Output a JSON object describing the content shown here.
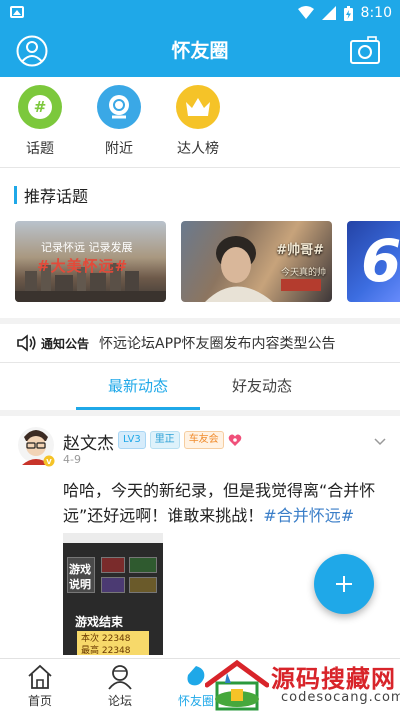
{
  "status_bar": {
    "time": "8:10"
  },
  "header": {
    "title": "怀友圈"
  },
  "quick_entries": [
    {
      "label": "话题",
      "icon": "hashtag-icon",
      "color": "#7cc83c"
    },
    {
      "label": "附近",
      "icon": "location-icon",
      "color": "#3aa8e6"
    },
    {
      "label": "达人榜",
      "icon": "crown-icon",
      "color": "#f5c328"
    }
  ],
  "topics": {
    "title": "推荐话题",
    "banners": [
      {
        "line1": "记录怀远 记录发展",
        "line2": "#大美怀远#"
      },
      {
        "tag": "#帅哥#",
        "tag2": "今天真的帅"
      },
      {
        "big": "6"
      }
    ]
  },
  "notice": {
    "tag": "通知公告",
    "text": "怀远论坛APP怀友圈发布内容类型公告"
  },
  "tabs": [
    {
      "label": "最新动态",
      "active": true
    },
    {
      "label": "好友动态",
      "active": false
    }
  ],
  "post": {
    "author": "赵文杰",
    "badges": [
      "LV3",
      "里正",
      "车友会"
    ],
    "date": "4-9",
    "text": "哈哈，今天的新纪录，但是我觉得离“合并怀远”还好远啊！谁敢来挑战！",
    "hashtag": "#合并怀远#",
    "image": {
      "label1": "游戏",
      "label2": "说明",
      "end": "游戏结束",
      "score_a": "本次 22348",
      "score_b": "最高 22348"
    }
  },
  "bottom_nav": [
    {
      "label": "首页",
      "icon": "home-icon",
      "active": false
    },
    {
      "label": "论坛",
      "icon": "forum-icon",
      "active": false
    },
    {
      "label": "怀友圈",
      "icon": "circle-icon",
      "active": true
    }
  ],
  "watermark": {
    "brand": "源码搜藏网",
    "domain": "codesocang.com"
  },
  "colors": {
    "primary": "#1fa8e8",
    "hashtag": "#3a7ec8",
    "watermark": "#d8242a"
  }
}
